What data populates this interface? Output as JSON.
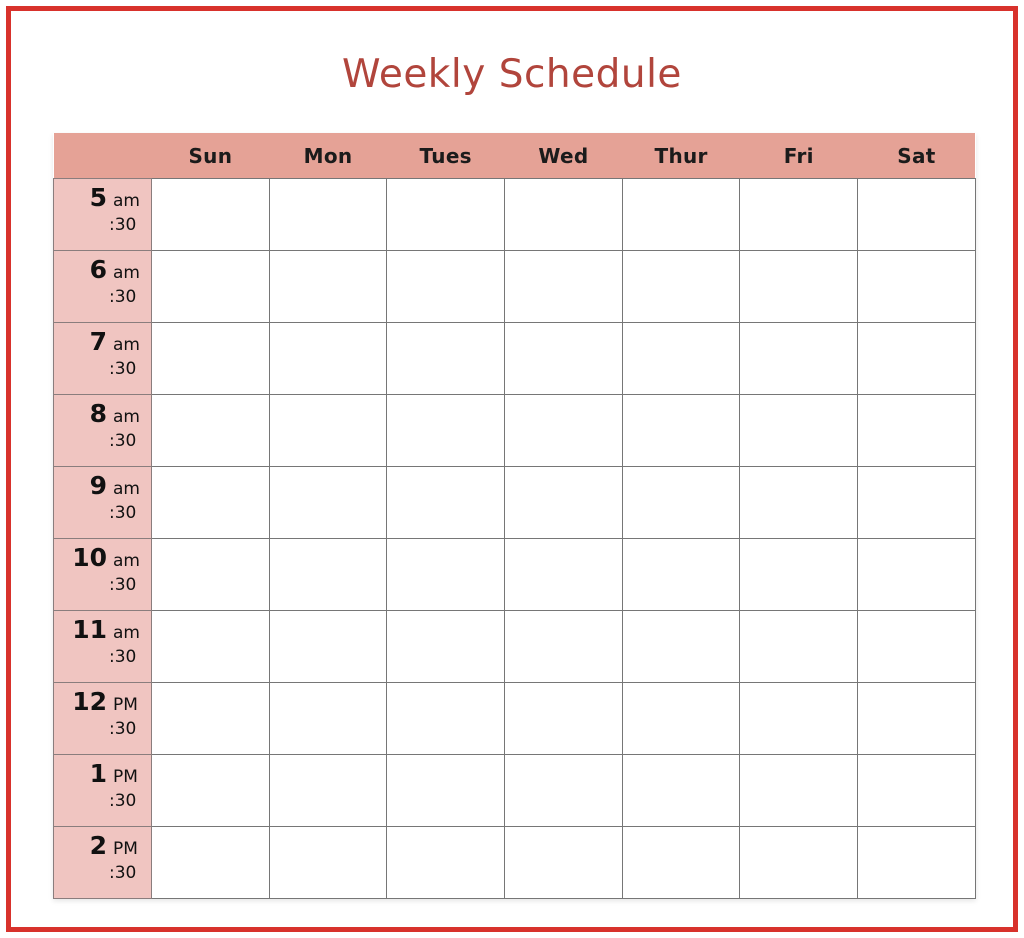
{
  "page": {
    "title": "Weekly Schedule",
    "border_color": "#d8322c",
    "background": "#ffffff",
    "title_color": "#b1453c"
  },
  "colors": {
    "header_background": "#e5a296",
    "time_column_background": "#f0c5c1",
    "cell_background": "#ffffff",
    "grid_line": "#767676",
    "text": "#111111"
  },
  "table": {
    "corner_header": "",
    "day_headers": [
      "Sun",
      "Mon",
      "Tues",
      "Wed",
      "Thur",
      "Fri",
      "Sat"
    ],
    "half_hour_label": ":30",
    "rows": [
      {
        "hour": "5",
        "meridiem": "am",
        "half": ":30"
      },
      {
        "hour": "6",
        "meridiem": "am",
        "half": ":30"
      },
      {
        "hour": "7",
        "meridiem": "am",
        "half": ":30"
      },
      {
        "hour": "8",
        "meridiem": "am",
        "half": ":30"
      },
      {
        "hour": "9",
        "meridiem": "am",
        "half": ":30"
      },
      {
        "hour": "10",
        "meridiem": "am",
        "half": ":30"
      },
      {
        "hour": "11",
        "meridiem": "am",
        "half": ":30"
      },
      {
        "hour": "12",
        "meridiem": "PM",
        "half": ":30"
      },
      {
        "hour": "1",
        "meridiem": "PM",
        "half": ":30"
      },
      {
        "hour": "2",
        "meridiem": "PM",
        "half": ":30"
      }
    ]
  }
}
